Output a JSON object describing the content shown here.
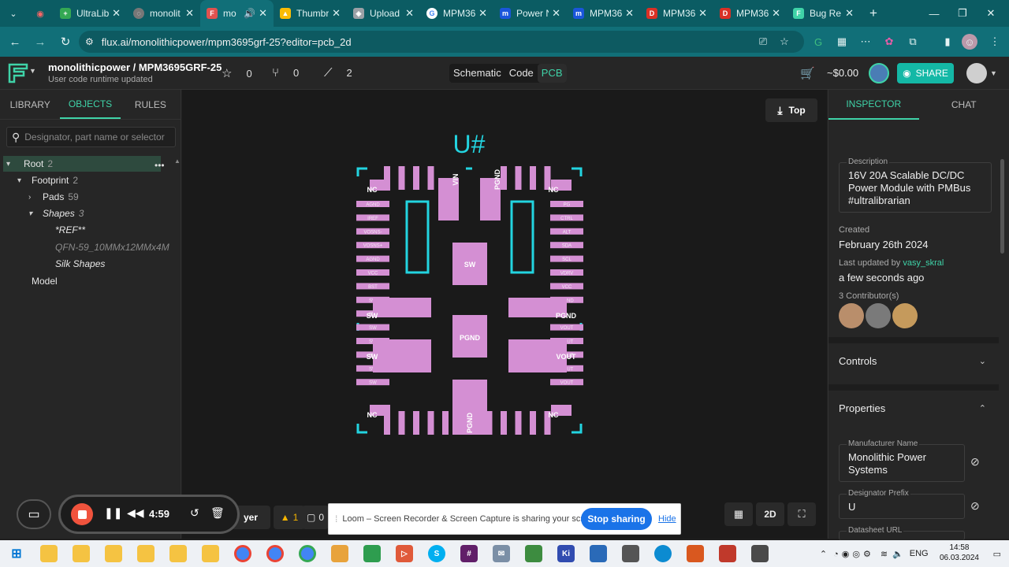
{
  "browser": {
    "tabs": [
      {
        "title": "UltraLib",
        "icon": "spreadsheet-icon",
        "color": "#34a853"
      },
      {
        "title": "monolit",
        "icon": "globe-icon",
        "color": "#8a8a8a"
      },
      {
        "title": "mo",
        "icon": "flux-icon",
        "color": "#e0524f",
        "active": true
      },
      {
        "title": "Thumbr",
        "icon": "drive-icon",
        "color": "#fbbc04"
      },
      {
        "title": "Upload",
        "icon": "layers-icon",
        "color": "#9aa0a6"
      },
      {
        "title": "MPM36",
        "icon": "google-icon",
        "color": "#4285f4"
      },
      {
        "title": "Power N",
        "icon": "mps-icon",
        "color": "#1a56db"
      },
      {
        "title": "MPM36",
        "icon": "mps-icon",
        "color": "#1a56db"
      },
      {
        "title": "MPM36",
        "icon": "pdf-icon",
        "color": "#d93025"
      },
      {
        "title": "MPM36",
        "icon": "pdf-icon",
        "color": "#d93025"
      },
      {
        "title": "Bug Re",
        "icon": "flux-icon",
        "color": "#3fd3a8"
      }
    ],
    "url": "flux.ai/monolithicpower/mpm3695grf-25?editor=pcb_2d"
  },
  "header": {
    "title": "monolithicpower / MPM3695GRF-25",
    "subtitle": "User code runtime updated",
    "stars": "0",
    "forks": "0",
    "activity": "2",
    "views": [
      "Schematic",
      "Code",
      "PCB"
    ],
    "active_view": "PCB",
    "price": "~$0.00",
    "share_label": "SHARE"
  },
  "left": {
    "tabs": [
      "LIBRARY",
      "OBJECTS",
      "RULES"
    ],
    "active_tab": "OBJECTS",
    "search_placeholder": "Designator, part name or selector",
    "tree": [
      {
        "label": "Root",
        "count": "2"
      },
      {
        "label": "Footprint",
        "count": "2"
      },
      {
        "label": "Pads",
        "count": "59"
      },
      {
        "label": "Shapes",
        "count": "3"
      },
      {
        "label": "*REF**"
      },
      {
        "label": "QFN-59_10MMx12MMx4M"
      },
      {
        "label": "Silk Shapes"
      },
      {
        "label": "Model"
      }
    ]
  },
  "canvas": {
    "top_label": "Top",
    "designator": "U#",
    "layer_label": "yer",
    "warnings": "1",
    "comments": "0",
    "mode_2d": "2D",
    "pads": {
      "big": [
        "SW",
        "PGND",
        "PGND",
        "SW",
        "SW",
        "PGND",
        "VOUT",
        "VIN",
        "PGND"
      ],
      "corner_nc": [
        "NC",
        "NC",
        "NC",
        "NC"
      ],
      "left_col": [
        "AGND",
        "IREF",
        "VOSNS-",
        "VOSNS+",
        "AGND",
        "VCC",
        "BST",
        "SW",
        "SW",
        "SW",
        "SW",
        "SW",
        "SW",
        "SW"
      ],
      "right_col": [
        "PG",
        "CTRL",
        "ALT",
        "SDA",
        "SCL",
        "VDRV",
        "VCC",
        "PGND",
        "VOUT",
        "VOUT",
        "VOUT",
        "VOUT",
        "VOUT"
      ]
    }
  },
  "inspector": {
    "tabs": [
      "INSPECTOR",
      "CHAT"
    ],
    "active_tab": "INSPECTOR",
    "description_label": "Description",
    "description": "16V 20A Scalable DC/DC Power Module with PMBus #ultralibrarian",
    "created_label": "Created",
    "created": "February 26th 2024",
    "updated_label": "Last updated by",
    "updated_by": "vasy_skral",
    "updated": "a few seconds ago",
    "contributors": "3 Contributor(s)",
    "controls": "Controls",
    "properties": "Properties",
    "manufacturer_label": "Manufacturer Name",
    "manufacturer": "Monolithic Power Systems",
    "prefix_label": "Designator Prefix",
    "prefix": "U",
    "datasheet_label": "Datasheet URL"
  },
  "loom": {
    "time": "4:59",
    "banner": "Loom – Screen Recorder & Screen Capture is sharing your screen.",
    "stop": "Stop sharing",
    "hide": "Hide"
  },
  "taskbar": {
    "time": "14:58",
    "date": "06.03.2024",
    "lang": "ENG"
  },
  "colors": {
    "accent": "#3fd3a8",
    "pad": "#d48fd3",
    "silkscreen": "#23d4e0",
    "browser_chrome": "#116f78"
  }
}
